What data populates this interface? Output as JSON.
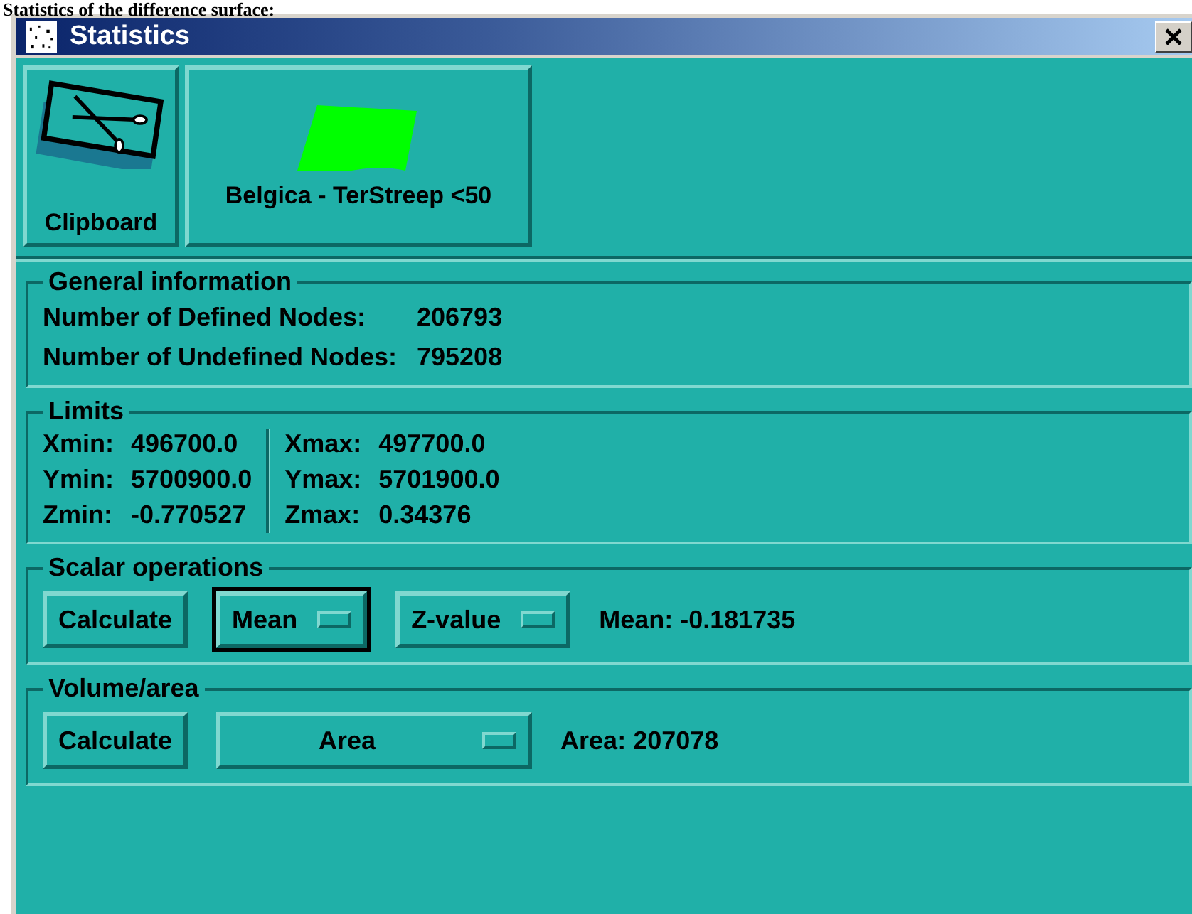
{
  "caption": "Statistics of the difference surface:",
  "window": {
    "title": "Statistics"
  },
  "toolbar": [
    {
      "kind": "clipboard",
      "label": "Clipboard"
    },
    {
      "kind": "surface",
      "label": "Belgica - TerStreep <50"
    }
  ],
  "general": {
    "title": "General information",
    "rows": [
      {
        "label": "Number of Defined Nodes:",
        "value": "206793"
      },
      {
        "label": "Number of Undefined Nodes:",
        "value": "795208"
      }
    ]
  },
  "limits": {
    "title": "Limits",
    "left": [
      {
        "label": "Xmin:",
        "value": "496700.0"
      },
      {
        "label": "Ymin:",
        "value": "5700900.0"
      },
      {
        "label": "Zmin:",
        "value": "-0.770527"
      }
    ],
    "right": [
      {
        "label": "Xmax:",
        "value": "497700.0"
      },
      {
        "label": "Ymax:",
        "value": "5701900.0"
      },
      {
        "label": "Zmax:",
        "value": "0.34376"
      }
    ]
  },
  "scalar": {
    "title": "Scalar operations",
    "button": "Calculate",
    "dropdowns": [
      {
        "label": "Mean",
        "focused": true
      },
      {
        "label": "Z-value",
        "focused": false
      }
    ],
    "result": "Mean: -0.181735"
  },
  "volume": {
    "title": "Volume/area",
    "button": "Calculate",
    "dropdowns": [
      {
        "label": "Area",
        "focused": false
      }
    ],
    "result": "Area: 207078"
  }
}
